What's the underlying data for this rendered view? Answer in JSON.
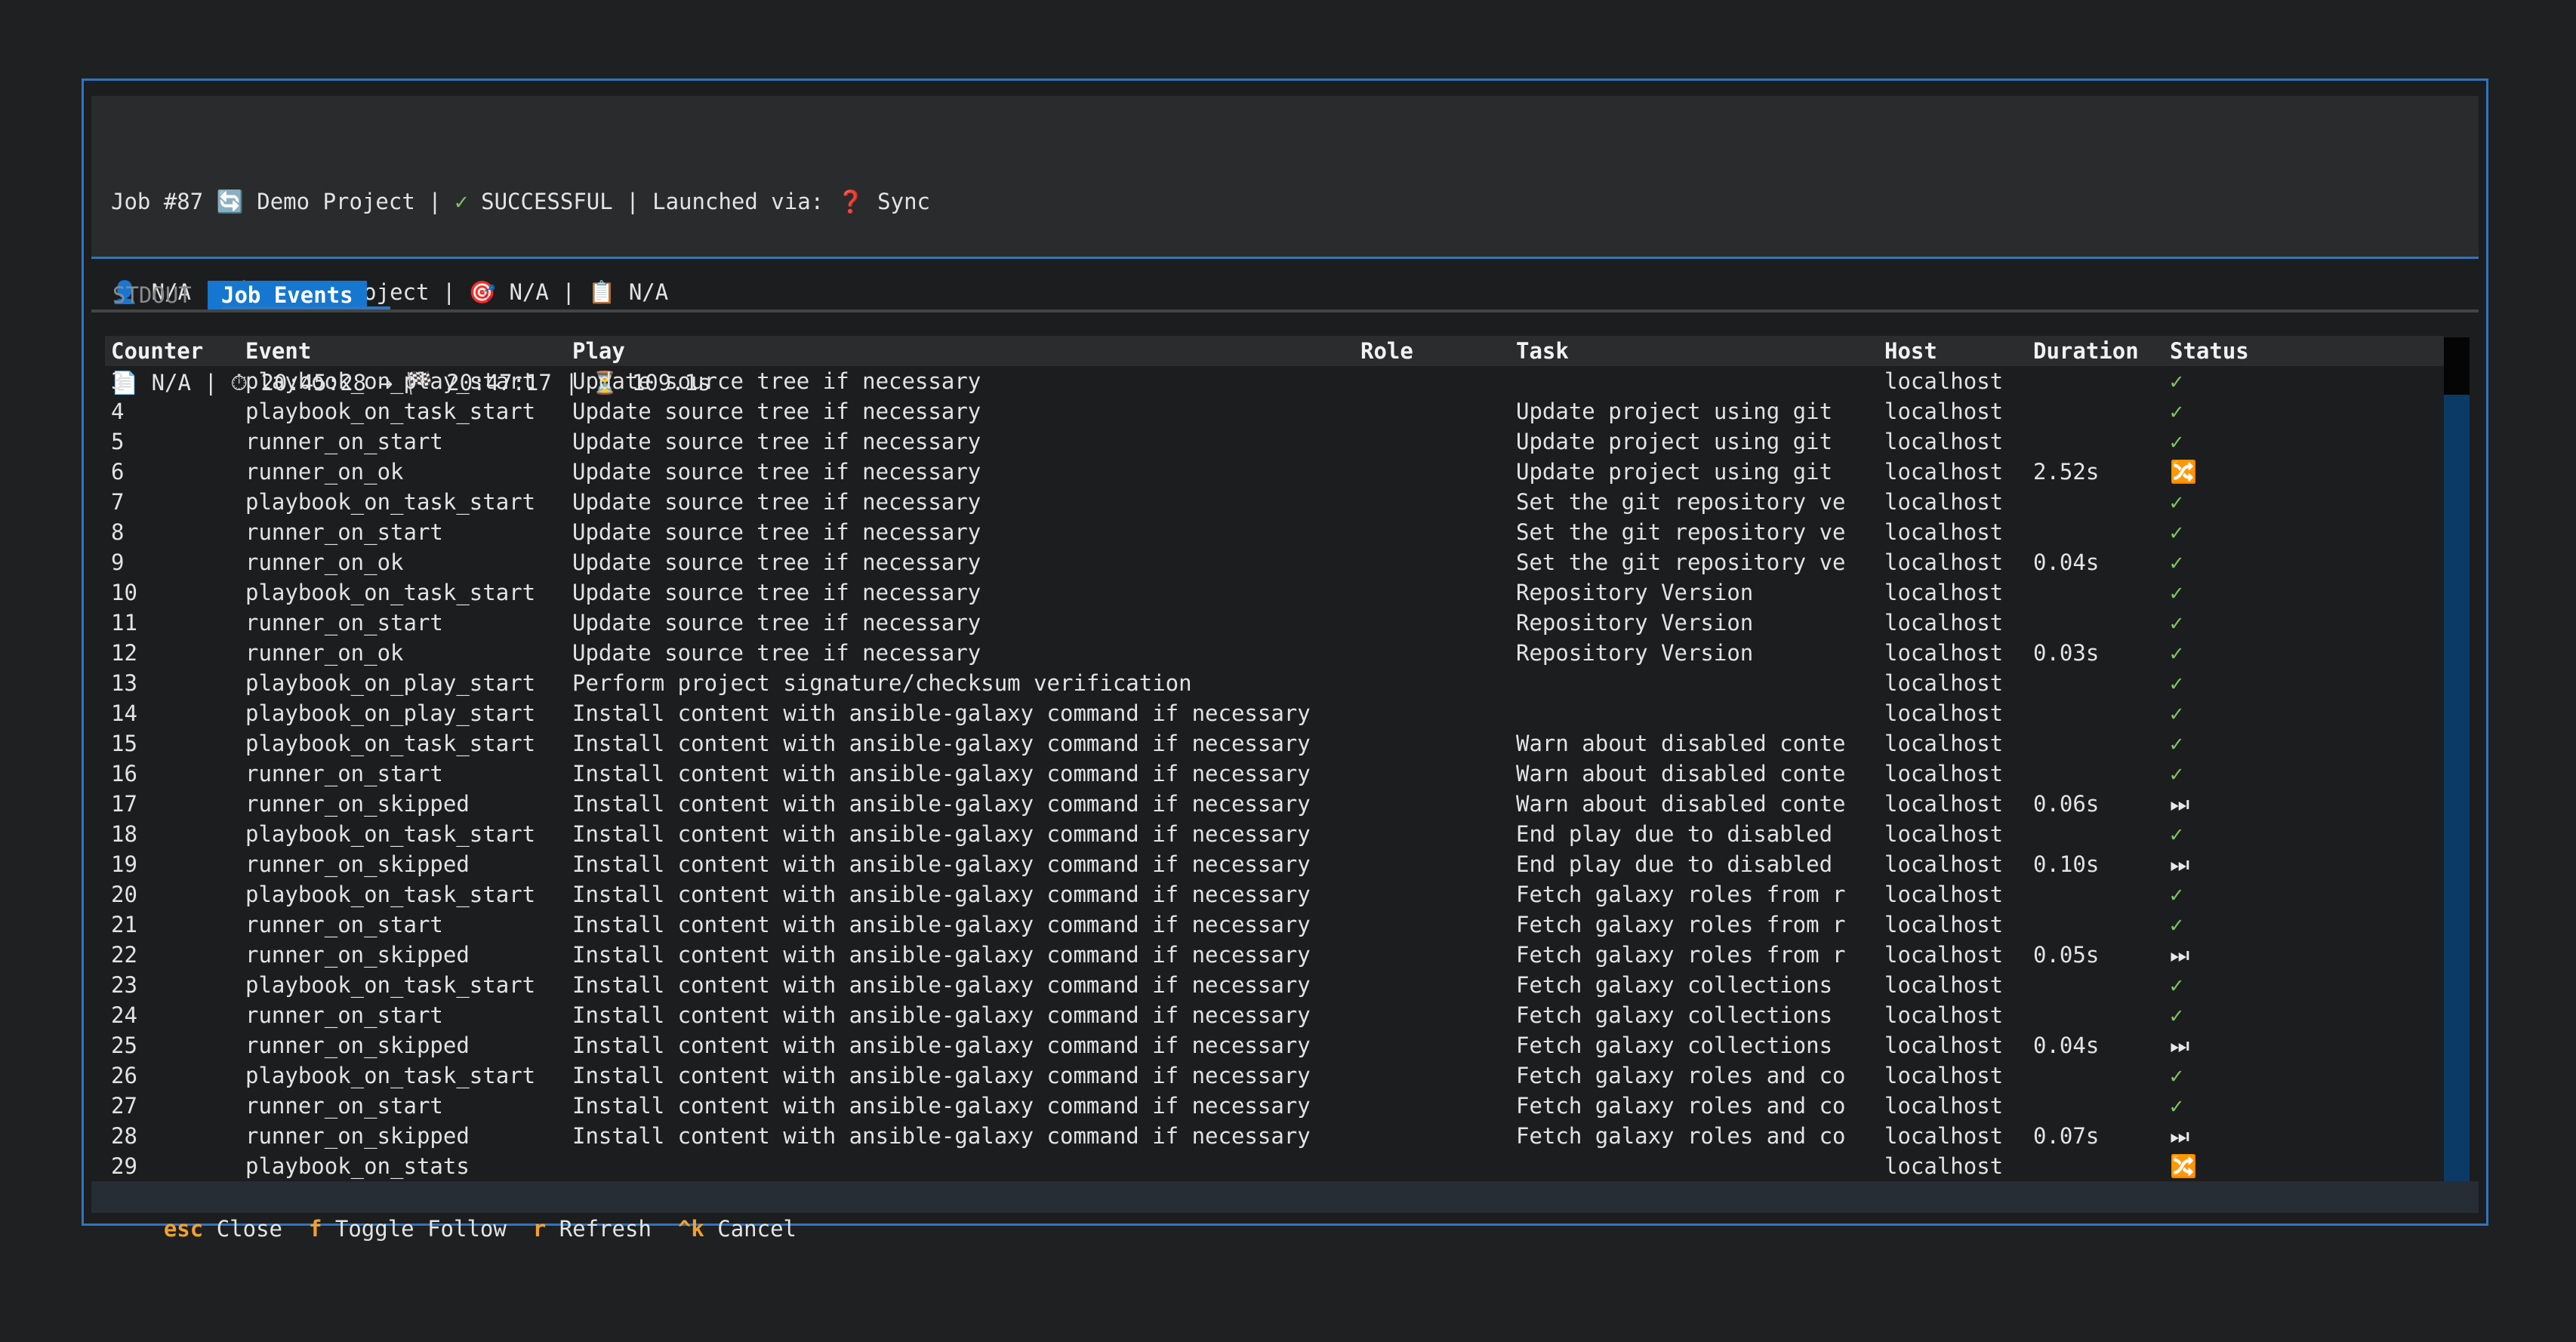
{
  "header": {
    "line1": {
      "job": "Job #87",
      "sync_icon": "🔄",
      "project": "Demo Project",
      "sep": "|",
      "status_icon": "✓",
      "status": "SUCCESSFUL",
      "launched": "Launched via:",
      "launch_icon": "❓",
      "launch_type": "Sync"
    },
    "line2": {
      "user_icon": "👤",
      "user": "N/A",
      "box_icon": "📦",
      "project": "Demo Project",
      "target_icon": "🎯",
      "inventory": "N/A",
      "clipboard_icon": "📋",
      "template": "N/A"
    },
    "line3": {
      "doc_icon": "📄",
      "playbook": "N/A",
      "clock_icon": "⏱",
      "started": "20:45:28",
      "arrow": "→",
      "flag_icon": "🏁",
      "finished": "20:47:17",
      "hourglass_icon": "⏳",
      "elapsed": "109.1s"
    }
  },
  "tabs": [
    {
      "label": "STDOUT"
    },
    {
      "label": "Job Events"
    }
  ],
  "table": {
    "columns": [
      "Counter",
      "Event",
      "Play",
      "Role",
      "Task",
      "Host",
      "Duration",
      "Status"
    ],
    "rows": [
      [
        "3",
        "playbook_on_play_start",
        "Update source tree if necessary",
        "",
        "",
        "localhost",
        "",
        "✓"
      ],
      [
        "4",
        "playbook_on_task_start",
        "Update source tree if necessary",
        "",
        "Update project using git",
        "localhost",
        "",
        "✓"
      ],
      [
        "5",
        "runner_on_start",
        "Update source tree if necessary",
        "",
        "Update project using git",
        "localhost",
        "",
        "✓"
      ],
      [
        "6",
        "runner_on_ok",
        "Update source tree if necessary",
        "",
        "Update project using git",
        "localhost",
        "2.52s",
        "🔀"
      ],
      [
        "7",
        "playbook_on_task_start",
        "Update source tree if necessary",
        "",
        "Set the git repository ve",
        "localhost",
        "",
        "✓"
      ],
      [
        "8",
        "runner_on_start",
        "Update source tree if necessary",
        "",
        "Set the git repository ve",
        "localhost",
        "",
        "✓"
      ],
      [
        "9",
        "runner_on_ok",
        "Update source tree if necessary",
        "",
        "Set the git repository ve",
        "localhost",
        "0.04s",
        "✓"
      ],
      [
        "10",
        "playbook_on_task_start",
        "Update source tree if necessary",
        "",
        "Repository Version",
        "localhost",
        "",
        "✓"
      ],
      [
        "11",
        "runner_on_start",
        "Update source tree if necessary",
        "",
        "Repository Version",
        "localhost",
        "",
        "✓"
      ],
      [
        "12",
        "runner_on_ok",
        "Update source tree if necessary",
        "",
        "Repository Version",
        "localhost",
        "0.03s",
        "✓"
      ],
      [
        "13",
        "playbook_on_play_start",
        "Perform project signature/checksum verification",
        "",
        "",
        "localhost",
        "",
        "✓"
      ],
      [
        "14",
        "playbook_on_play_start",
        "Install content with ansible-galaxy command if necessary",
        "",
        "",
        "localhost",
        "",
        "✓"
      ],
      [
        "15",
        "playbook_on_task_start",
        "Install content with ansible-galaxy command if necessary",
        "",
        "Warn about disabled conte",
        "localhost",
        "",
        "✓"
      ],
      [
        "16",
        "runner_on_start",
        "Install content with ansible-galaxy command if necessary",
        "",
        "Warn about disabled conte",
        "localhost",
        "",
        "✓"
      ],
      [
        "17",
        "runner_on_skipped",
        "Install content with ansible-galaxy command if necessary",
        "",
        "Warn about disabled conte",
        "localhost",
        "0.06s",
        "⏭"
      ],
      [
        "18",
        "playbook_on_task_start",
        "Install content with ansible-galaxy command if necessary",
        "",
        "End play due to disabled",
        "localhost",
        "",
        "✓"
      ],
      [
        "19",
        "runner_on_skipped",
        "Install content with ansible-galaxy command if necessary",
        "",
        "End play due to disabled",
        "localhost",
        "0.10s",
        "⏭"
      ],
      [
        "20",
        "playbook_on_task_start",
        "Install content with ansible-galaxy command if necessary",
        "",
        "Fetch galaxy roles from r",
        "localhost",
        "",
        "✓"
      ],
      [
        "21",
        "runner_on_start",
        "Install content with ansible-galaxy command if necessary",
        "",
        "Fetch galaxy roles from r",
        "localhost",
        "",
        "✓"
      ],
      [
        "22",
        "runner_on_skipped",
        "Install content with ansible-galaxy command if necessary",
        "",
        "Fetch galaxy roles from r",
        "localhost",
        "0.05s",
        "⏭"
      ],
      [
        "23",
        "playbook_on_task_start",
        "Install content with ansible-galaxy command if necessary",
        "",
        "Fetch galaxy collections",
        "localhost",
        "",
        "✓"
      ],
      [
        "24",
        "runner_on_start",
        "Install content with ansible-galaxy command if necessary",
        "",
        "Fetch galaxy collections",
        "localhost",
        "",
        "✓"
      ],
      [
        "25",
        "runner_on_skipped",
        "Install content with ansible-galaxy command if necessary",
        "",
        "Fetch galaxy collections",
        "localhost",
        "0.04s",
        "⏭"
      ],
      [
        "26",
        "playbook_on_task_start",
        "Install content with ansible-galaxy command if necessary",
        "",
        "Fetch galaxy roles and co",
        "localhost",
        "",
        "✓"
      ],
      [
        "27",
        "runner_on_start",
        "Install content with ansible-galaxy command if necessary",
        "",
        "Fetch galaxy roles and co",
        "localhost",
        "",
        "✓"
      ],
      [
        "28",
        "runner_on_skipped",
        "Install content with ansible-galaxy command if necessary",
        "",
        "Fetch galaxy roles and co",
        "localhost",
        "0.07s",
        "⏭"
      ],
      [
        "29",
        "playbook_on_stats",
        "",
        "",
        "",
        "localhost",
        "",
        "🔀"
      ]
    ]
  },
  "footer": [
    {
      "key": "esc",
      "label": "Close"
    },
    {
      "key": "f",
      "label": "Toggle Follow"
    },
    {
      "key": "r",
      "label": "Refresh"
    },
    {
      "key": "^k",
      "label": "Cancel"
    }
  ],
  "colors": {
    "accent": "#1677d0",
    "border": "#2f75be",
    "ok": "#7cc463",
    "key": "#f0a030"
  }
}
